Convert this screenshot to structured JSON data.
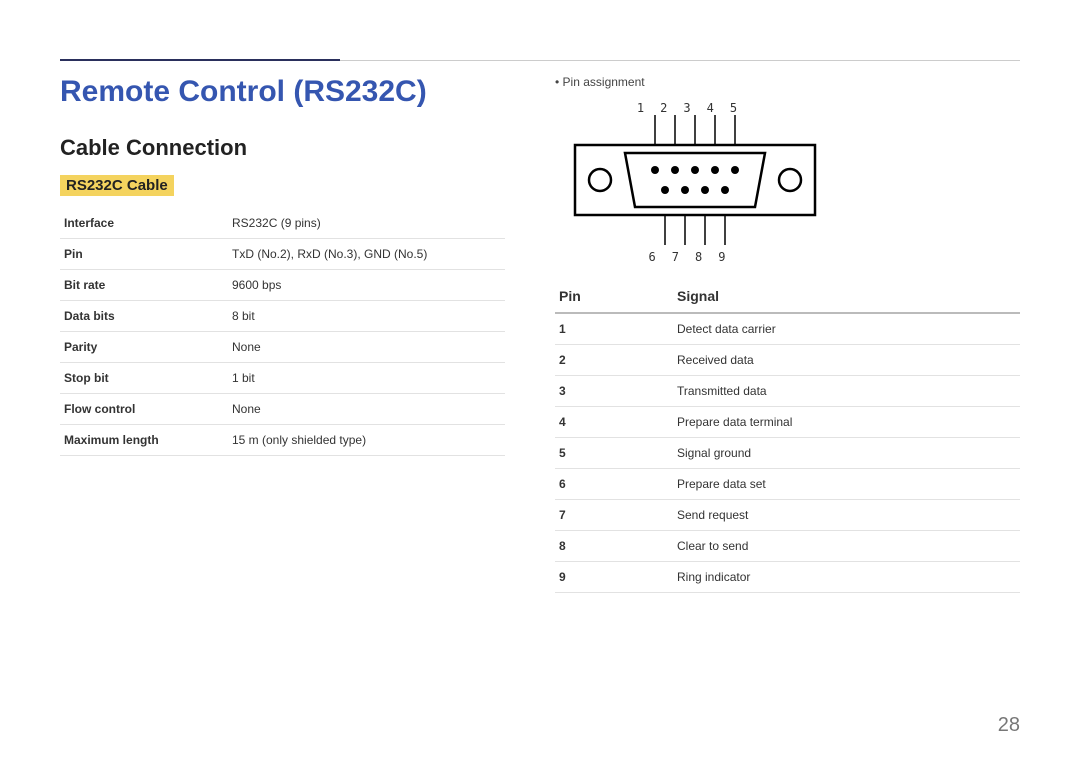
{
  "title": "Remote Control (RS232C)",
  "subhead": "Cable Connection",
  "tag": "RS232C Cable",
  "spec": [
    {
      "k": "Interface",
      "v": "RS232C (9 pins)"
    },
    {
      "k": "Pin",
      "v": "TxD (No.2), RxD (No.3), GND (No.5)"
    },
    {
      "k": "Bit rate",
      "v": "9600 bps"
    },
    {
      "k": "Data bits",
      "v": "8 bit"
    },
    {
      "k": "Parity",
      "v": "None"
    },
    {
      "k": "Stop bit",
      "v": "1 bit"
    },
    {
      "k": "Flow control",
      "v": "None"
    },
    {
      "k": "Maximum length",
      "v": "15 m (only shielded type)"
    }
  ],
  "bullet": "Pin assignment",
  "pins_top": [
    "1",
    "2",
    "3",
    "4",
    "5"
  ],
  "pins_bottom": [
    "6",
    "7",
    "8",
    "9"
  ],
  "signal_headers": {
    "pin": "Pin",
    "signal": "Signal"
  },
  "signals": [
    {
      "pin": "1",
      "sig": "Detect data carrier"
    },
    {
      "pin": "2",
      "sig": "Received data"
    },
    {
      "pin": "3",
      "sig": "Transmitted data"
    },
    {
      "pin": "4",
      "sig": "Prepare data terminal"
    },
    {
      "pin": "5",
      "sig": "Signal ground"
    },
    {
      "pin": "6",
      "sig": "Prepare data set"
    },
    {
      "pin": "7",
      "sig": "Send request"
    },
    {
      "pin": "8",
      "sig": "Clear to send"
    },
    {
      "pin": "9",
      "sig": "Ring indicator"
    }
  ],
  "page_number": "28"
}
